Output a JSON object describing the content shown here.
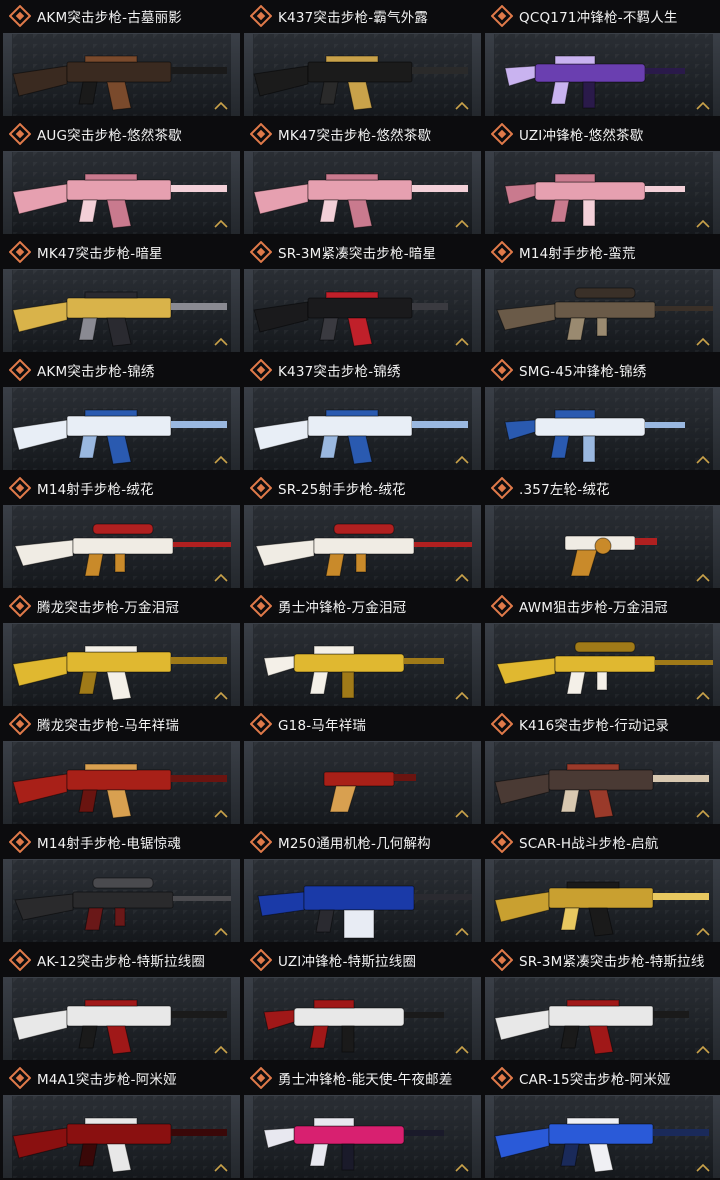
{
  "items": [
    {
      "label": "AKM突击步枪-古墓丽影",
      "weapon_icon": "assault-rifle",
      "colors": [
        "#3a2a20",
        "#7a4a2c",
        "#1a1a1a"
      ]
    },
    {
      "label": "K437突击步枪-霸气外露",
      "weapon_icon": "assault-rifle",
      "colors": [
        "#1b1b1b",
        "#c9a24a",
        "#2a2a2a"
      ]
    },
    {
      "label": "QCQ171冲锋枪-不羁人生",
      "weapon_icon": "smg",
      "colors": [
        "#6a3fb0",
        "#c9b3f0",
        "#2a1a4a"
      ]
    },
    {
      "label": "AUG突击步枪-悠然茶歇",
      "weapon_icon": "bullpup-rifle",
      "colors": [
        "#e6a0b0",
        "#c97a8e",
        "#f3d0d8"
      ]
    },
    {
      "label": "MK47突击步枪-悠然茶歇",
      "weapon_icon": "assault-rifle",
      "colors": [
        "#e6a0b0",
        "#c97a8e",
        "#f3d0d8"
      ]
    },
    {
      "label": "UZI冲锋枪-悠然茶歇",
      "weapon_icon": "smg",
      "colors": [
        "#e6a0b0",
        "#c97a8e",
        "#f3d0d8"
      ]
    },
    {
      "label": "MK47突击步枪-暗星",
      "weapon_icon": "assault-rifle",
      "colors": [
        "#d9b34a",
        "#2a2a30",
        "#8a8a92"
      ]
    },
    {
      "label": "SR-3M紧凑突击步枪-暗星",
      "weapon_icon": "compact-rifle",
      "colors": [
        "#1a1a1c",
        "#c0202a",
        "#3a3a40"
      ]
    },
    {
      "label": "M14射手步枪-蛮荒",
      "weapon_icon": "marksman-rifle",
      "colors": [
        "#6a5a48",
        "#9a8a70",
        "#3a3028"
      ]
    },
    {
      "label": "AKM突击步枪-锦绣",
      "weapon_icon": "assault-rifle",
      "colors": [
        "#e8eef6",
        "#2a5ab0",
        "#9ab8e0"
      ]
    },
    {
      "label": "K437突击步枪-锦绣",
      "weapon_icon": "assault-rifle",
      "colors": [
        "#e8eef6",
        "#2a5ab0",
        "#9ab8e0"
      ]
    },
    {
      "label": "SMG-45冲锋枪-锦绣",
      "weapon_icon": "smg",
      "colors": [
        "#e8eef6",
        "#2a5ab0",
        "#9ab8e0"
      ]
    },
    {
      "label": "M14射手步枪-绒花",
      "weapon_icon": "marksman-rifle",
      "colors": [
        "#f0ece4",
        "#c98a2a",
        "#b02020"
      ]
    },
    {
      "label": "SR-25射手步枪-绒花",
      "weapon_icon": "marksman-rifle",
      "colors": [
        "#f0ece4",
        "#c98a2a",
        "#b02020"
      ]
    },
    {
      "label": ".357左轮-绒花",
      "weapon_icon": "revolver",
      "colors": [
        "#f0ece4",
        "#c98a2a",
        "#b02020"
      ]
    },
    {
      "label": "腾龙突击步枪-万金泪冠",
      "weapon_icon": "assault-rifle",
      "colors": [
        "#e0b830",
        "#f4f0e8",
        "#a07a18"
      ]
    },
    {
      "label": "勇士冲锋枪-万金泪冠",
      "weapon_icon": "smg",
      "colors": [
        "#e0b830",
        "#f4f0e8",
        "#a07a18"
      ]
    },
    {
      "label": "AWM狙击步枪-万金泪冠",
      "weapon_icon": "sniper-rifle",
      "colors": [
        "#e0b830",
        "#f4f0e8",
        "#a07a18"
      ]
    },
    {
      "label": "腾龙突击步枪-马年祥瑞",
      "weapon_icon": "assault-rifle",
      "colors": [
        "#a82018",
        "#d8a050",
        "#6a1410"
      ]
    },
    {
      "label": "G18-马年祥瑞",
      "weapon_icon": "pistol",
      "colors": [
        "#a82018",
        "#d8a050",
        "#6a1410"
      ]
    },
    {
      "label": "K416突击步枪-行动记录",
      "weapon_icon": "assault-rifle",
      "colors": [
        "#4a3a34",
        "#9a3a2a",
        "#d8c8b0"
      ]
    },
    {
      "label": "M14射手步枪-电锯惊魂",
      "weapon_icon": "marksman-rifle",
      "colors": [
        "#2a2a2c",
        "#6a1818",
        "#4a4a4e"
      ]
    },
    {
      "label": "M250通用机枪-几何解构",
      "weapon_icon": "machine-gun",
      "colors": [
        "#1a3aa8",
        "#e8ecf4",
        "#2a2a30"
      ]
    },
    {
      "label": "SCAR-H战斗步枪-启航",
      "weapon_icon": "battle-rifle",
      "colors": [
        "#c9a030",
        "#1a1a1a",
        "#e8c860"
      ]
    },
    {
      "label": "AK-12突击步枪-特斯拉线圈",
      "weapon_icon": "assault-rifle",
      "colors": [
        "#e8e8e8",
        "#a01818",
        "#1a1a1a"
      ]
    },
    {
      "label": "UZI冲锋枪-特斯拉线圈",
      "weapon_icon": "smg",
      "colors": [
        "#e8e8e8",
        "#a01818",
        "#1a1a1a"
      ]
    },
    {
      "label": "SR-3M紧凑突击步枪-特斯拉线",
      "weapon_icon": "compact-rifle",
      "colors": [
        "#e8e8e8",
        "#a01818",
        "#1a1a1a"
      ]
    },
    {
      "label": "M4A1突击步枪-阿米娅",
      "weapon_icon": "assault-rifle",
      "colors": [
        "#8a1010",
        "#e8e8e8",
        "#3a0808"
      ]
    },
    {
      "label": "勇士冲锋枪-能天使-午夜邮差",
      "weapon_icon": "smg",
      "colors": [
        "#d82070",
        "#e8e8f0",
        "#1a1a2a"
      ]
    },
    {
      "label": "CAR-15突击步枪-阿米娅",
      "weapon_icon": "assault-rifle",
      "colors": [
        "#2a5ad8",
        "#f0f0f4",
        "#1a2a5a"
      ]
    }
  ],
  "accent_color": "#e07a4a"
}
